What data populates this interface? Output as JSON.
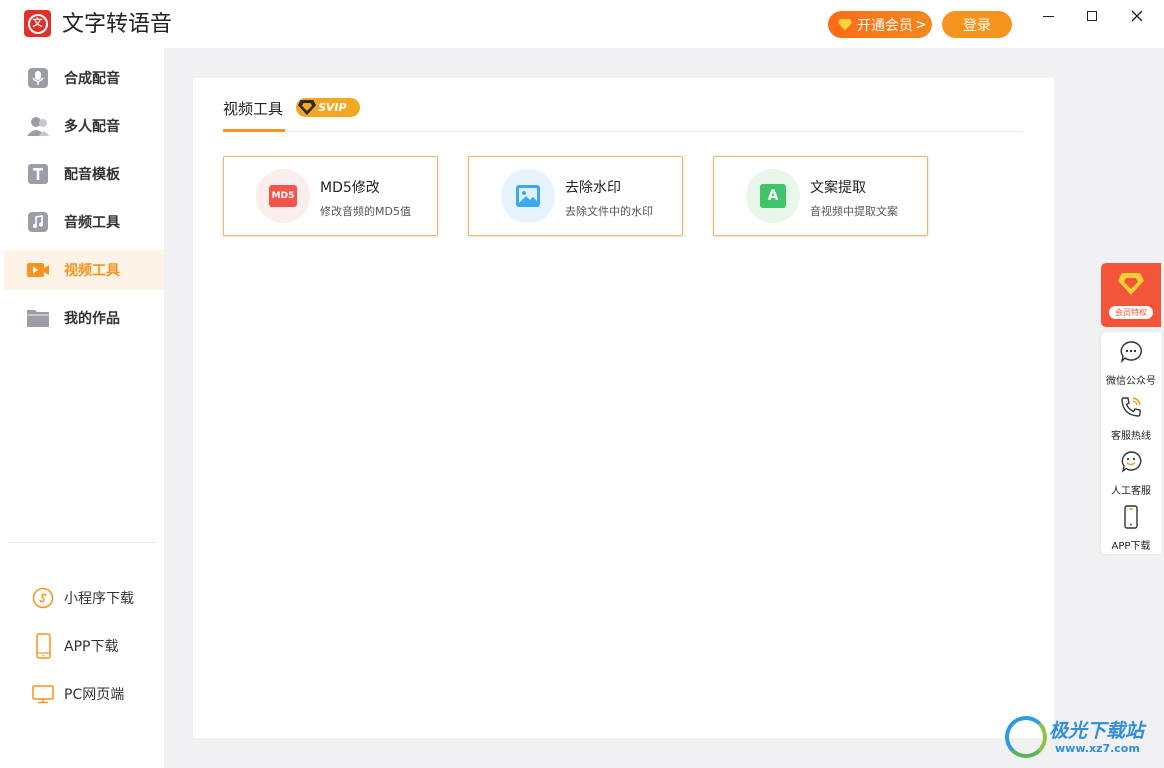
{
  "app": {
    "title": "文字转语音",
    "logo_char": "文",
    "vip_button": "开通会员",
    "vip_arrow": ">",
    "login_button": "登录"
  },
  "sidebar": {
    "items": [
      {
        "label": "合成配音",
        "icon": "microphone-icon"
      },
      {
        "label": "多人配音",
        "icon": "users-icon"
      },
      {
        "label": "配音模板",
        "icon": "template-icon"
      },
      {
        "label": "音频工具",
        "icon": "music-note-icon"
      },
      {
        "label": "视频工具",
        "icon": "video-camera-icon",
        "active": true
      },
      {
        "label": "我的作品",
        "icon": "folder-icon"
      }
    ],
    "links": [
      {
        "label": "小程序下载",
        "icon": "mini-program-icon"
      },
      {
        "label": "APP下载",
        "icon": "phone-icon"
      },
      {
        "label": "PC网页端",
        "icon": "monitor-icon"
      }
    ]
  },
  "main": {
    "tab_label": "视频工具",
    "badge": "SVIP",
    "cards": [
      {
        "title": "MD5修改",
        "desc": "修改音频的MD5值",
        "icon": "md5-icon",
        "icon_text": "MD5"
      },
      {
        "title": "去除水印",
        "desc": "去除文件中的水印",
        "icon": "image-icon"
      },
      {
        "title": "文案提取",
        "desc": "音视频中提取文案",
        "icon": "text-extract-icon",
        "icon_text": "A"
      }
    ]
  },
  "float_bar": {
    "promo_label": "会员特权",
    "items": [
      {
        "label": "微信公众号",
        "icon": "chat-bubble-icon"
      },
      {
        "label": "客服热线",
        "icon": "phone-call-icon"
      },
      {
        "label": "人工客服",
        "icon": "smile-chat-icon"
      },
      {
        "label": "APP下载",
        "icon": "mobile-icon"
      }
    ]
  },
  "watermark": {
    "name": "极光下载站",
    "url": "www.xz7.com"
  },
  "colors": {
    "accent": "#f7941d",
    "vip_gradient": "#ff6a1a",
    "promo": "#f2553a",
    "background": "#f1f1f3"
  }
}
